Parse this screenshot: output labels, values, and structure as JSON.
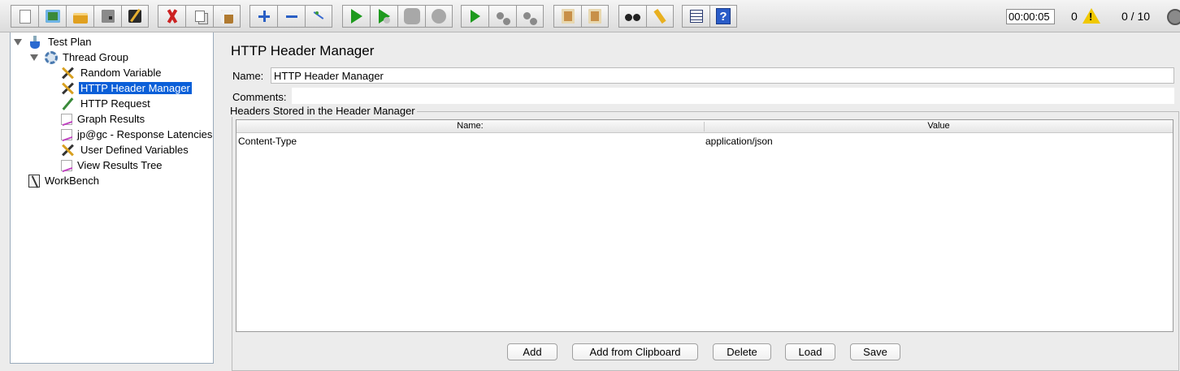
{
  "toolbar": {
    "icons": [
      "new-icon",
      "template-icon",
      "open-icon",
      "save-icon",
      "save-as-icon",
      "cut-icon",
      "copy-icon",
      "paste-icon",
      "expand-icon",
      "collapse-icon",
      "toggle-icon",
      "start-icon",
      "start-no-timers-icon",
      "stop-icon",
      "shutdown-icon",
      "remote-start-icon",
      "remote-stop-icon",
      "remote-shutdown-icon",
      "clear-icon",
      "clear-all-icon",
      "search-icon",
      "reset-search-icon",
      "function-helper-icon",
      "help-icon"
    ]
  },
  "status": {
    "elapsed_time": "00:00:05",
    "error_count": "0",
    "warning_symbol": "!",
    "threads": "0 / 10"
  },
  "tree": {
    "test_plan": "Test Plan",
    "thread_group": "Thread Group",
    "items": [
      "Random Variable",
      "HTTP Header Manager",
      "HTTP Request",
      "Graph Results",
      "jp@gc - Response Latencies",
      "User Defined Variables",
      "View Results Tree"
    ],
    "workbench": "WorkBench",
    "selected": "HTTP Header Manager"
  },
  "panel": {
    "title": "HTTP Header Manager",
    "name_label": "Name:",
    "name_value": "HTTP Header Manager",
    "comments_label": "Comments:",
    "headers_legend": "Headers Stored in the Header Manager",
    "columns": [
      "Name:",
      "Value"
    ],
    "rows": [
      {
        "name": "Content-Type",
        "value": "application/json"
      }
    ],
    "buttons": {
      "add": "Add",
      "add_from_clipboard": "Add from Clipboard",
      "delete": "Delete",
      "load": "Load",
      "save": "Save"
    }
  },
  "colors": {
    "selection": "#0b5fd8",
    "background": "#ececec",
    "warning": "#f0c800"
  }
}
